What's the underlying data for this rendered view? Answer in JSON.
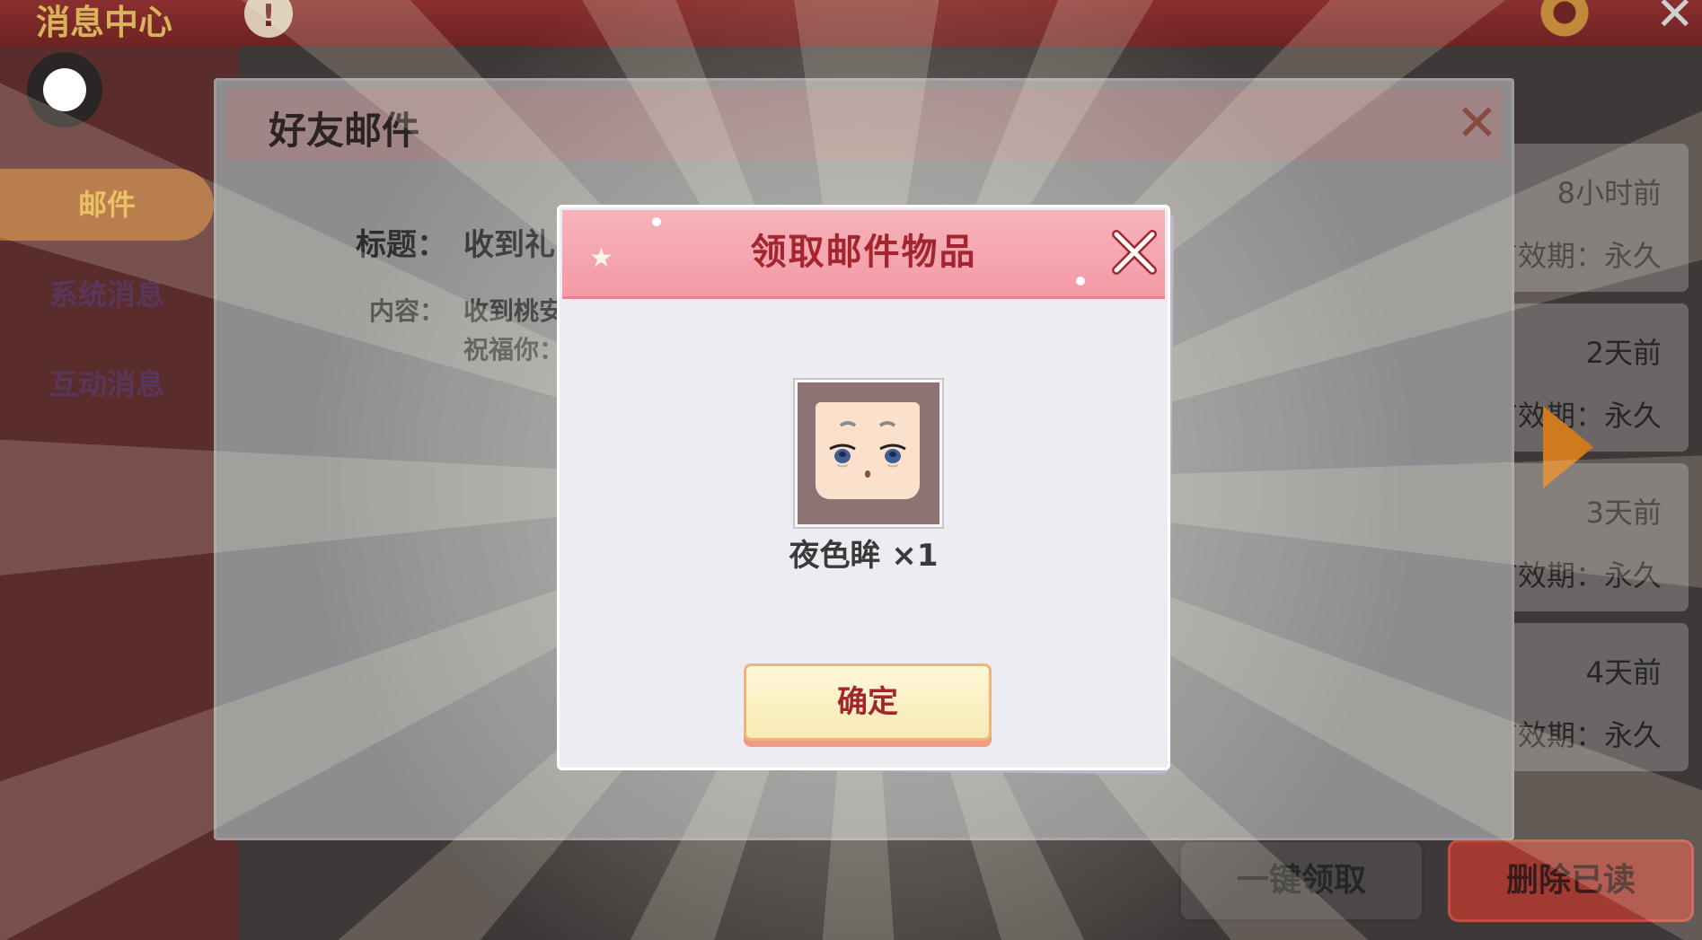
{
  "topbar": {
    "title": "消息中心",
    "info_glyph": "!",
    "close_glyph": "✕"
  },
  "sidebar": {
    "items": [
      {
        "label": "邮件",
        "active": true
      },
      {
        "label": "系统消息"
      },
      {
        "label": "互动消息"
      }
    ]
  },
  "mail_list": [
    {
      "time": "8小时前",
      "validity": "有效期：永久"
    },
    {
      "time": "2天前",
      "validity": "有效期：永久"
    },
    {
      "time": "3天前",
      "validity": "有效期：永久"
    },
    {
      "time": "4天前",
      "validity": "有效期：永久"
    }
  ],
  "bottom_buttons": {
    "claim_all": "一键领取",
    "delete_read": "删除已读"
  },
  "friend_mail": {
    "title": "好友邮件",
    "subject_label": "标题：",
    "subject_value": "收到礼",
    "content_label": "内容：",
    "content_line1": "收到桃安",
    "content_line2": "祝福你："
  },
  "claim_dialog": {
    "title": "领取邮件物品",
    "item_name": "夜色眸 ×1",
    "confirm_label": "确定",
    "item_icon": "face-icon"
  },
  "colors": {
    "accent_red": "#a3262e",
    "header_pink": "#f39aa6",
    "arrow_orange": "#d07a20"
  }
}
